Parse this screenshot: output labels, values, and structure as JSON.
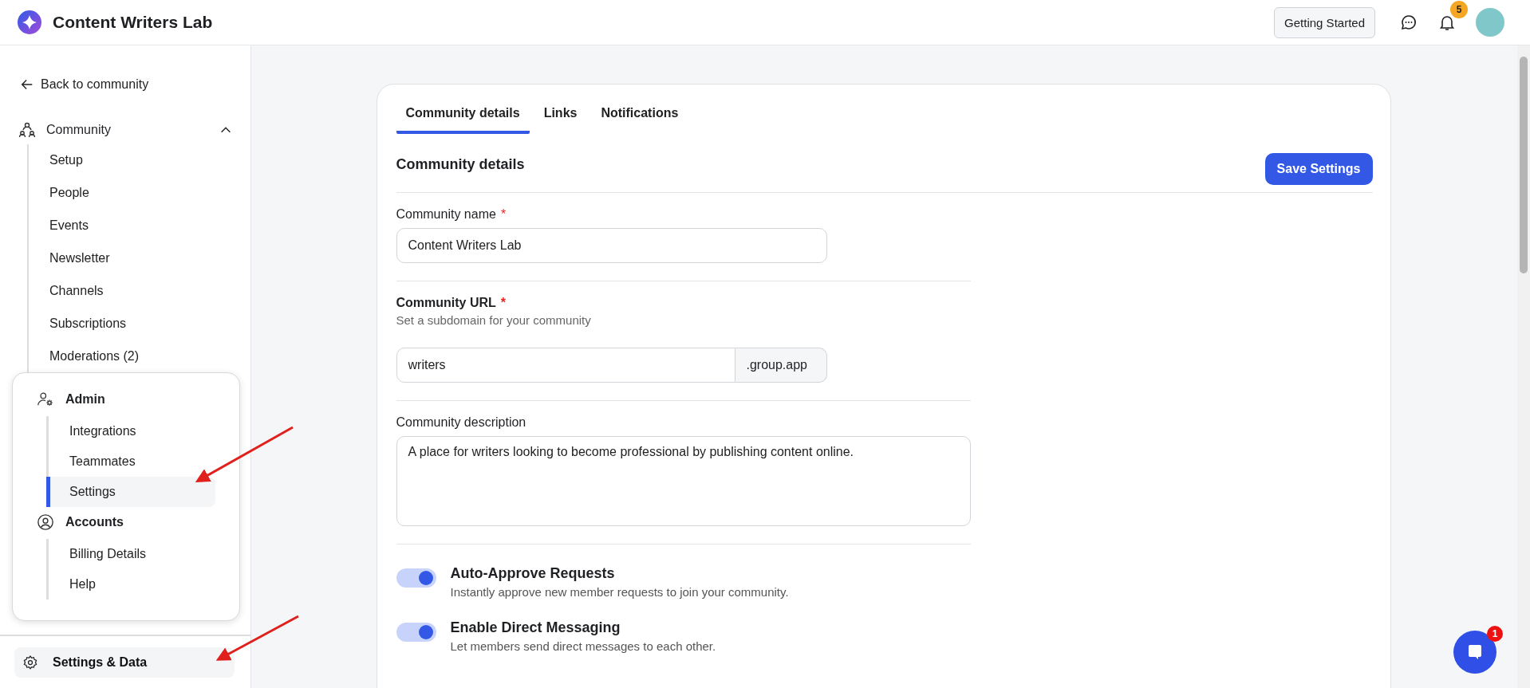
{
  "app": {
    "name": "Content Writers Lab"
  },
  "header": {
    "getting_started": "Getting Started",
    "notification_count": "5"
  },
  "sidebar": {
    "back_link": "Back to community",
    "community": {
      "label": "Community",
      "expanded": true,
      "items": [
        {
          "label": "Setup"
        },
        {
          "label": "People"
        },
        {
          "label": "Events"
        },
        {
          "label": "Newsletter"
        },
        {
          "label": "Channels"
        },
        {
          "label": "Subscriptions"
        },
        {
          "label": "Moderations (2)"
        }
      ]
    },
    "admin_menu": [
      {
        "label": "Admin",
        "kind": "admin",
        "items": [
          {
            "label": "Integrations",
            "selected": false
          },
          {
            "label": "Teammates",
            "selected": false
          },
          {
            "label": "Settings",
            "selected": true
          }
        ]
      },
      {
        "label": "Accounts",
        "kind": "accounts",
        "items": [
          {
            "label": "Billing Details",
            "selected": false
          },
          {
            "label": "Help",
            "selected": false
          }
        ]
      }
    ],
    "settings_data": "Settings & Data"
  },
  "tabs": [
    {
      "label": "Community details",
      "selected": true
    },
    {
      "label": "Links",
      "selected": false
    },
    {
      "label": "Notifications",
      "selected": false
    }
  ],
  "section": {
    "title": "Community details",
    "save_button": "Save Settings"
  },
  "community_name": {
    "label": "Community name",
    "required_mark": "*",
    "value": "Content Writers Lab"
  },
  "community_url": {
    "label": "Community URL",
    "required_mark": "*",
    "hint": "Set a subdomain for your community",
    "value": "writers",
    "suffix": ".group.app"
  },
  "community_description": {
    "label": "Community description",
    "value": "A place for writers looking to become professional by publishing content online."
  },
  "toggles": [
    {
      "label": "Auto-Approve Requests",
      "description": "Instantly approve new member requests to join your community.",
      "on": true
    },
    {
      "label": "Enable Direct Messaging",
      "description": "Let members send direct messages to each other.",
      "on": true
    }
  ],
  "chat_widget": {
    "badge": "1"
  }
}
